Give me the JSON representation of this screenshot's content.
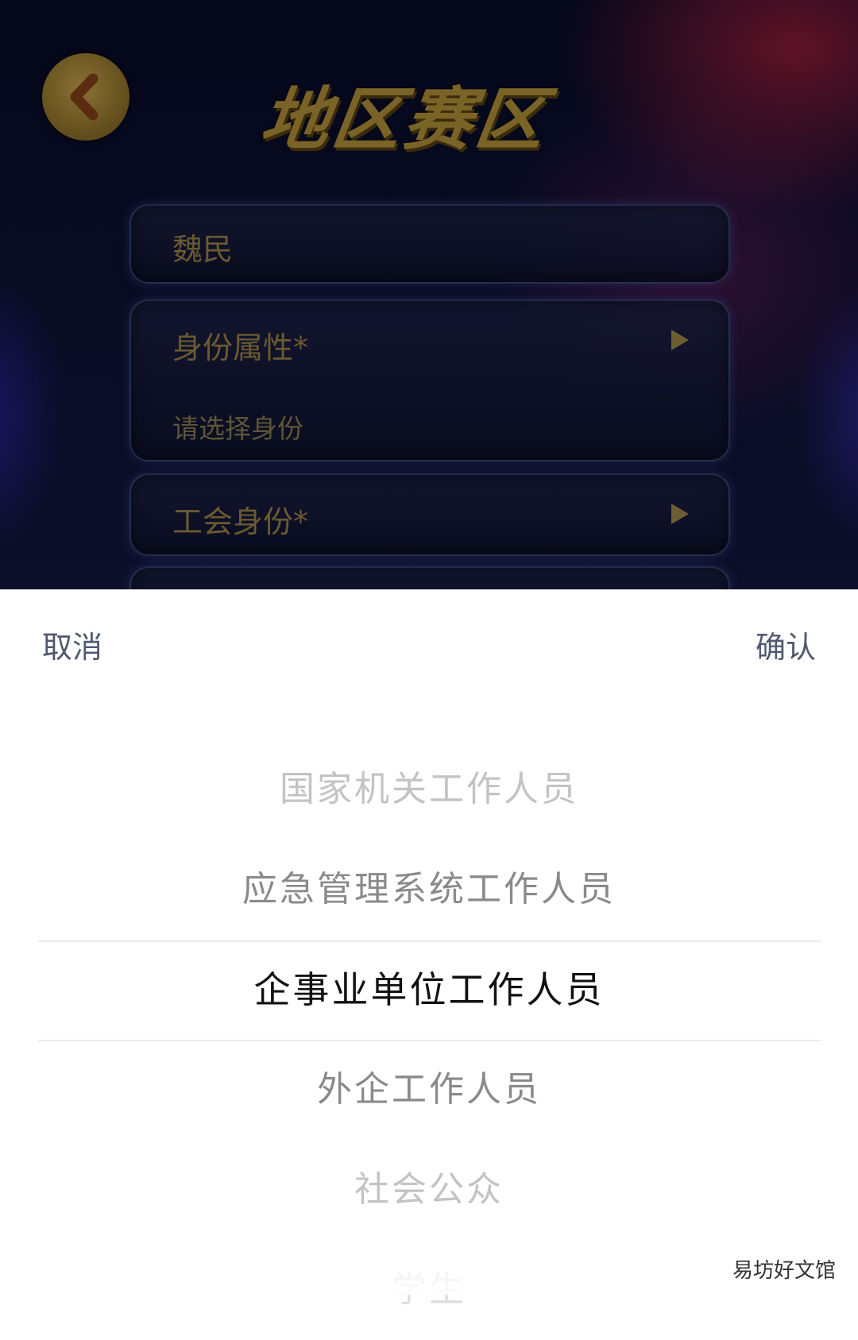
{
  "header": {
    "title": "地区赛区"
  },
  "form": {
    "name_value": "魏民",
    "identity_label": "身份属性*",
    "identity_placeholder": "请选择身份",
    "union_label": "工会身份*"
  },
  "picker": {
    "cancel_label": "取消",
    "confirm_label": "确认",
    "options": [
      "国家机关工作人员",
      "应急管理系统工作人员",
      "企事业单位工作人员",
      "外企工作人员",
      "社会公众",
      "学生"
    ],
    "selected": "企事业单位工作人员"
  },
  "watermark": "易坊好文馆",
  "colors": {
    "title_gold": "#7a6326",
    "selected_text": "#111111",
    "header_action": "#505a6e"
  }
}
